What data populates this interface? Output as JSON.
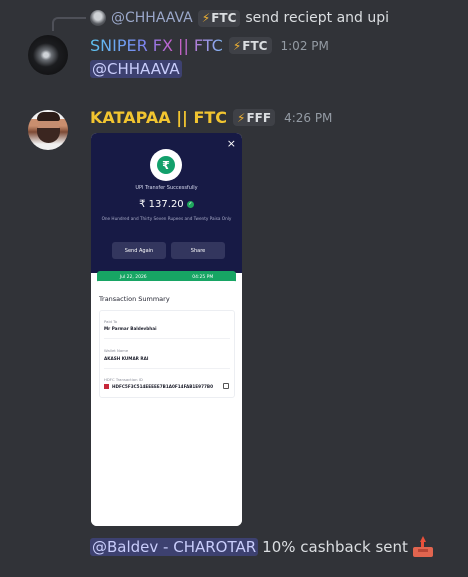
{
  "reply": {
    "name": "@CHHAAVA",
    "tag": "FTC",
    "text": "send reciept and upi"
  },
  "messages": [
    {
      "username": "SNIPER FX || FTC",
      "tag": "FTC",
      "timestamp": "1:02 PM",
      "mention": "@CHHAAVA"
    },
    {
      "username": "KATAPAA || FTC",
      "tag": "FFF",
      "timestamp": "4:26 PM"
    }
  ],
  "receipt": {
    "close": "×",
    "status": "UPI Transfer Successfully",
    "amount": "₹ 137.20",
    "amount_words": "One Hundred and Thirty Seven Rupees and Twenty Paisa Only",
    "send_again": "Send Again",
    "share": "Share",
    "date": "Jul 22, 2026",
    "time": "04:25 PM",
    "summary_title": "Transaction Summary",
    "paid_to_label": "Paid To",
    "paid_to": "Mr Parmar Baldevbhai",
    "wallet_label": "Wallet Name",
    "wallet": "AKASH KUMAR RAI",
    "txn_label": "HDFC Transaction ID",
    "txn_id": "HDFC5F3C514EEEEE7B1A0F14FAB1E977B0"
  },
  "bottom": {
    "mention": "@Baldev - CHAROTAR",
    "text": "10% cashback sent"
  },
  "colors": {
    "background": "#313338",
    "mention_bg": "#3c4270",
    "katapaa_name": "#f2c530",
    "bolt": "#f0b232"
  },
  "icons": {
    "tag_icon": "lightning-bolt-icon",
    "bottom_emoji": "outbox-tray-icon"
  }
}
